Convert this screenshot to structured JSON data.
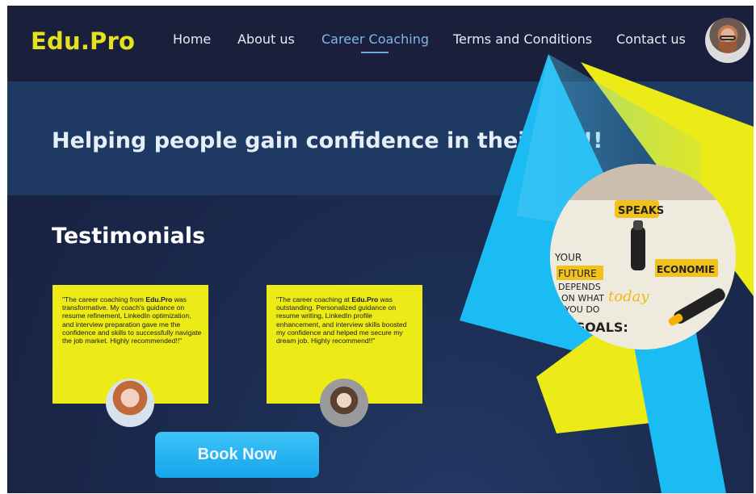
{
  "brand": {
    "name": "Edu.Pro"
  },
  "nav": {
    "items": [
      {
        "label": "Home"
      },
      {
        "label": "About us"
      },
      {
        "label": "Career Coaching",
        "active": true
      },
      {
        "label": "Terms and Conditions"
      },
      {
        "label": "Contact us"
      }
    ]
  },
  "hero": {
    "title": "Helping people gain confidence in their life!!"
  },
  "testimonials": {
    "title": "Testimonials",
    "items": [
      {
        "prefix": "\"The career coaching from ",
        "brand": "Edu.Pro",
        "suffix": " was transformative. My coach's guidance on resume refinement, LinkedIn optimization, and interview preparation gave me the confidence and skills to successfully navigate the job market. Highly recommended!!\""
      },
      {
        "prefix": "\"The career coaching at ",
        "brand": "Edu.Pro",
        "suffix": " was outstanding. Personalized guidance on resume writing, LinkedIn profile enhancement, and interview skills boosted my confidence and helped me secure my dream job. Highly recommend!!\""
      }
    ]
  },
  "cta": {
    "label": "Book Now"
  },
  "photo_text": {
    "t1": "SPEAKS",
    "t2": "YOUR",
    "t3": "FUTURE",
    "t4": "DEPENDS",
    "t5": "ON WHAT",
    "t6": "YOU DO",
    "t7": "today",
    "t8": "ECONOMIE",
    "t9": "GOALS:"
  },
  "colors": {
    "brand_yellow": "#e4e21d",
    "nav_bg": "#1a1f3c",
    "hero_band": "#1e3a62",
    "card_yellow": "#ecea17",
    "button_blue": "#1aa9ee",
    "accent_cyan": "#1bbcf3"
  },
  "icons": {
    "profile_avatar": "avatar-photo-icon"
  }
}
